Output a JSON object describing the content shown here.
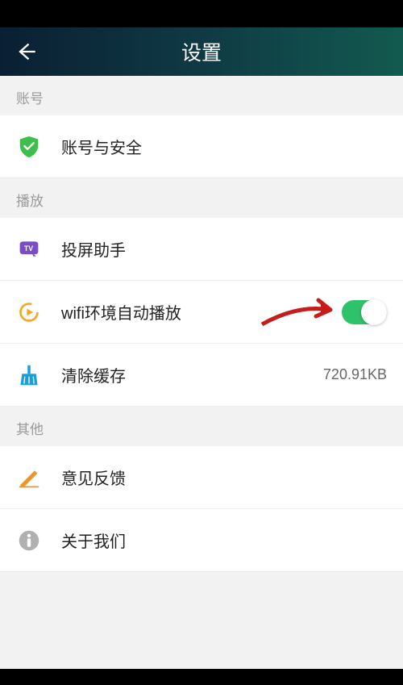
{
  "header": {
    "title": "设置"
  },
  "sections": {
    "account": {
      "header": "账号",
      "items": {
        "security": {
          "label": "账号与安全"
        }
      }
    },
    "playback": {
      "header": "播放",
      "items": {
        "cast": {
          "label": "投屏助手"
        },
        "wifi_autoplay": {
          "label": "wifi环境自动播放",
          "toggle_on": true
        },
        "clear_cache": {
          "label": "清除缓存",
          "value": "720.91KB"
        }
      }
    },
    "other": {
      "header": "其他",
      "items": {
        "feedback": {
          "label": "意见反馈"
        },
        "about": {
          "label": "关于我们"
        }
      }
    }
  }
}
